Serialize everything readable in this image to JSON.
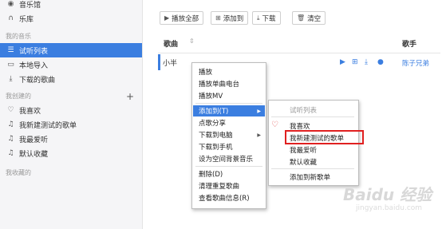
{
  "sidebar": {
    "top_items": [
      {
        "label": "音乐馆",
        "icon": "music-hall-icon"
      },
      {
        "label": "乐库",
        "icon": "headphone-icon"
      }
    ],
    "my_music_title": "我的音乐",
    "my_music_items": [
      {
        "label": "试听列表",
        "icon": "playlist-icon",
        "active": true
      },
      {
        "label": "本地导入",
        "icon": "monitor-icon"
      },
      {
        "label": "下载的歌曲",
        "icon": "download-icon"
      }
    ],
    "created_title": "我创建的",
    "created_items": [
      {
        "label": "我喜欢",
        "icon": "heart-icon"
      },
      {
        "label": "我新建测试的歌单",
        "icon": "note-icon"
      },
      {
        "label": "我最爱听",
        "icon": "note-icon"
      },
      {
        "label": "默认收藏",
        "icon": "note-icon"
      }
    ],
    "collected_title": "我收藏的"
  },
  "toolbar": {
    "play_all": "播放全部",
    "add_to": "添加到",
    "download": "下载",
    "clear": "清空"
  },
  "table": {
    "col_song": "歌曲",
    "col_artist": "歌手",
    "row": {
      "song": "小半",
      "artist": "陈子兄弟"
    }
  },
  "context_menu": {
    "items": [
      "播放",
      "播放单曲电台",
      "播放MV",
      "添加到(T)",
      "点歌分享",
      "下载到电脑",
      "下载到手机",
      "设为空间背景音乐",
      "删除(D)",
      "清理重复歌曲",
      "查看歌曲信息(R)"
    ],
    "highlighted": "添加到(T)"
  },
  "submenu": {
    "items": [
      "试听列表",
      "我喜欢",
      "我新建测试的歌单",
      "我最爱听",
      "默认收藏",
      "添加到新歌单"
    ],
    "disabled": "试听列表",
    "marked": "我新建测试的歌单"
  },
  "watermark": {
    "main": "Baidu 经验",
    "sub": "jingyan.baidu.com"
  },
  "colors": {
    "accent": "#3b7ee0",
    "highlight_box": "#e02020",
    "heart": "#e25555"
  }
}
